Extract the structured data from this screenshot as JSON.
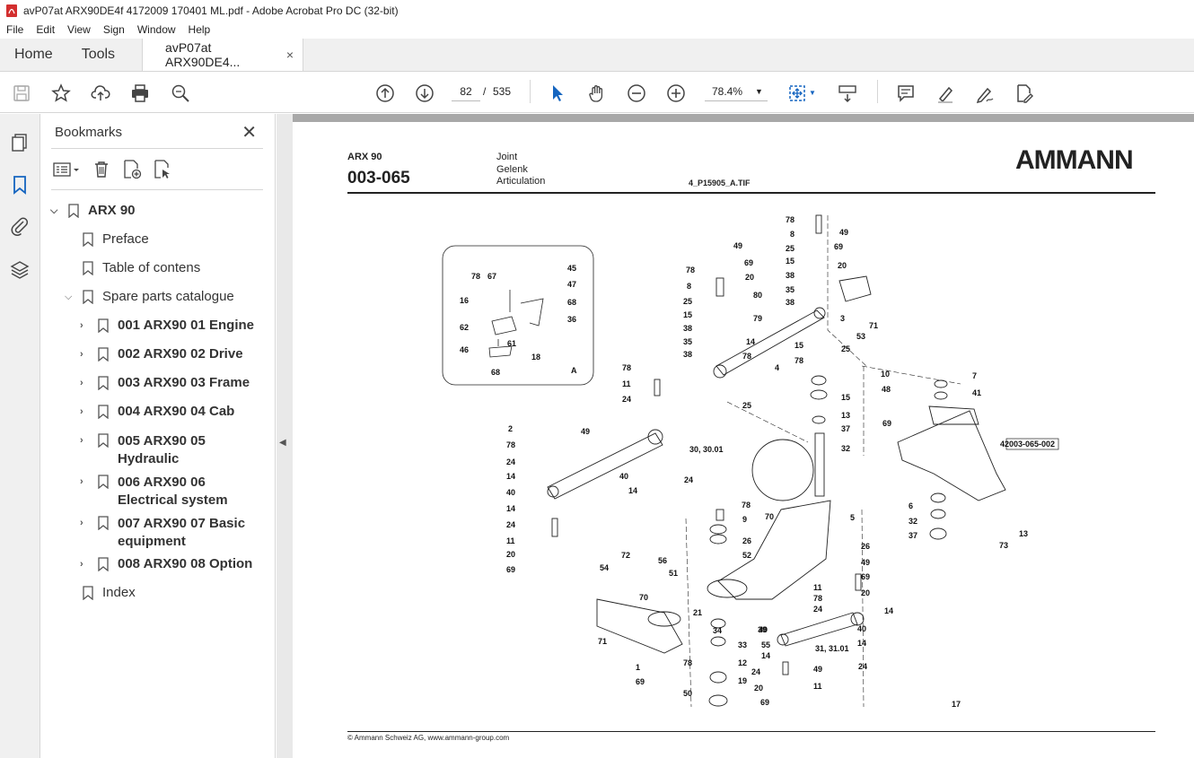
{
  "window": {
    "title": "avP07at ARX90DE4f 4172009 170401 ML.pdf - Adobe Acrobat Pro DC (32-bit)"
  },
  "menu": [
    "File",
    "Edit",
    "View",
    "Sign",
    "Window",
    "Help"
  ],
  "tabs": {
    "home": "Home",
    "tools": "Tools",
    "doc": "avP07at ARX90DE4...",
    "close": "×"
  },
  "toolbar": {
    "page_current": "82",
    "page_sep": "/",
    "page_total": "535",
    "zoom": "78.4%"
  },
  "bookmarks": {
    "title": "Bookmarks",
    "items": [
      {
        "label": "ARX 90"
      },
      {
        "label": "Preface"
      },
      {
        "label": "Table of contens"
      },
      {
        "label": "Spare parts catalogue"
      },
      {
        "label": "001 ARX90 01 Engine"
      },
      {
        "label": "002 ARX90 02 Drive"
      },
      {
        "label": "003 ARX90 03 Frame"
      },
      {
        "label": "004 ARX90 04 Cab"
      },
      {
        "label": "005 ARX90 05 Hydraulic"
      },
      {
        "label": "006 ARX90 06 Electrical system"
      },
      {
        "label": "007 ARX90 07 Basic equipment"
      },
      {
        "label": "008 ARX90 08 Option"
      },
      {
        "label": "Index"
      }
    ]
  },
  "document": {
    "model": "ARX 90",
    "code": "003-065",
    "desc1": "Joint",
    "desc2": "Gelenk",
    "desc3": "Articulation",
    "file": "4_P15905_A.TIF",
    "logo": "AMMANN",
    "footer": "© Ammann Schweiz AG, www.ammann-group.com",
    "detail_label": "A",
    "ref_box": "003-065-002",
    "callouts": [
      "78",
      "8",
      "25",
      "15",
      "38",
      "35",
      "38",
      "15",
      "25",
      "78",
      "49",
      "69",
      "20",
      "78",
      "8",
      "25",
      "15",
      "38",
      "35",
      "38",
      "80",
      "79",
      "4",
      "3",
      "71",
      "53",
      "49",
      "69",
      "20",
      "78",
      "11",
      "24",
      "14",
      "78",
      "25",
      "15",
      "13",
      "37",
      "32",
      "10",
      "48",
      "69",
      "7",
      "41",
      "42",
      "2",
      "78",
      "24",
      "14",
      "40",
      "14",
      "24",
      "11",
      "20",
      "69",
      "49",
      "30, 30.01",
      "40",
      "14",
      "24",
      "78",
      "9",
      "26",
      "52",
      "70",
      "5",
      "6",
      "32",
      "37",
      "13",
      "73",
      "54",
      "72",
      "56",
      "51",
      "70",
      "21",
      "34",
      "39",
      "40",
      "33",
      "12",
      "19",
      "26",
      "49",
      "69",
      "20",
      "11",
      "78",
      "24",
      "14",
      "31, 31.01",
      "40",
      "14",
      "24",
      "78",
      "71",
      "1",
      "69",
      "50",
      "55",
      "14",
      "24",
      "20",
      "69",
      "49",
      "11",
      "78",
      "67",
      "45",
      "47",
      "68",
      "16",
      "62",
      "36",
      "61",
      "46",
      "18",
      "68",
      "17"
    ]
  }
}
